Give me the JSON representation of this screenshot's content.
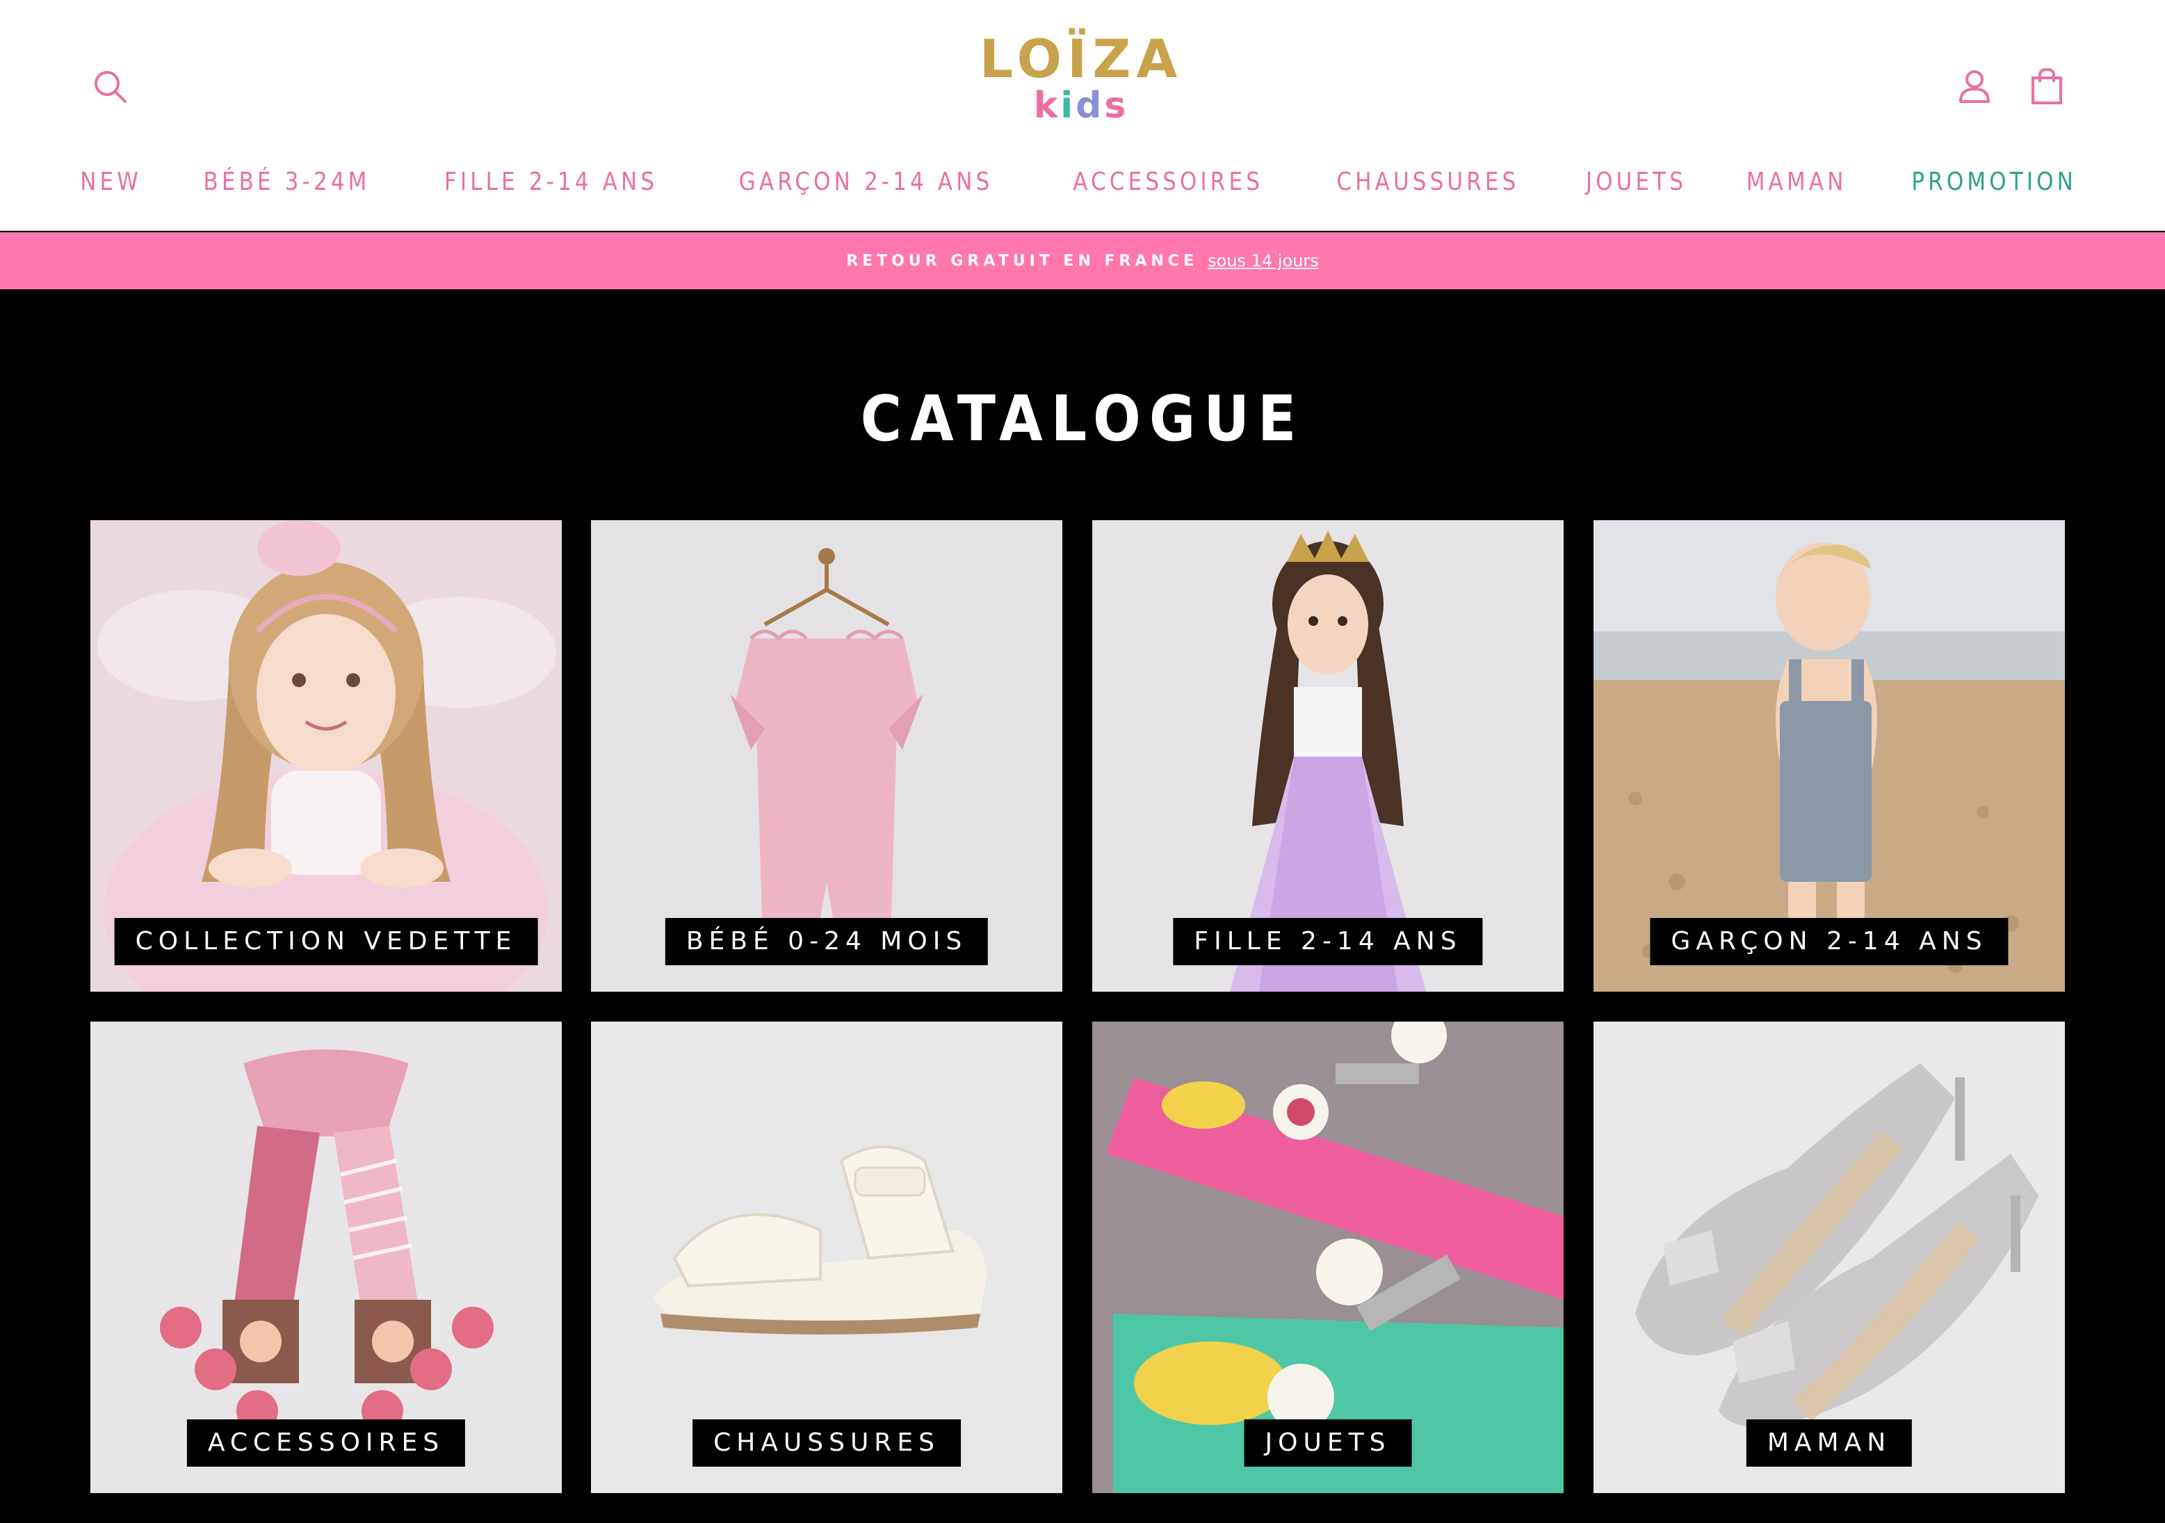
{
  "header": {
    "logo": {
      "top": "LOÏZA",
      "sub_k": "k",
      "sub_i": "i",
      "sub_d": "d",
      "sub_s": "s"
    },
    "icons": {
      "search": "search-icon",
      "account": "user-icon",
      "cart": "shopping-bag-icon"
    },
    "colors": {
      "nav": "#e96fa4",
      "promo": "#2aa38b",
      "logo_gold": "#c9a24c"
    }
  },
  "nav": [
    {
      "label": "NEW"
    },
    {
      "label": "BÉBÉ 3-24M"
    },
    {
      "label": "FILLE 2-14 ANS"
    },
    {
      "label": "GARÇON 2-14 ANS"
    },
    {
      "label": "ACCESSOIRES"
    },
    {
      "label": "CHAUSSURES"
    },
    {
      "label": "JOUETS"
    },
    {
      "label": "MAMAN"
    },
    {
      "label": "PROMOTION"
    }
  ],
  "announcement": {
    "text": "RETOUR GRATUIT EN FRANCE",
    "link": "sous 14 jours",
    "bg_color": "#ff77ad"
  },
  "catalogue": {
    "title": "CATALOGUE",
    "tiles": [
      {
        "label": "COLLECTION VEDETTE"
      },
      {
        "label": "BÉBÉ 0-24 MOIS"
      },
      {
        "label": "FILLE 2-14 ANS"
      },
      {
        "label": "GARÇON 2-14 ANS"
      },
      {
        "label": "ACCESSOIRES"
      },
      {
        "label": "CHAUSSURES"
      },
      {
        "label": "JOUETS"
      },
      {
        "label": "MAMAN"
      }
    ]
  }
}
